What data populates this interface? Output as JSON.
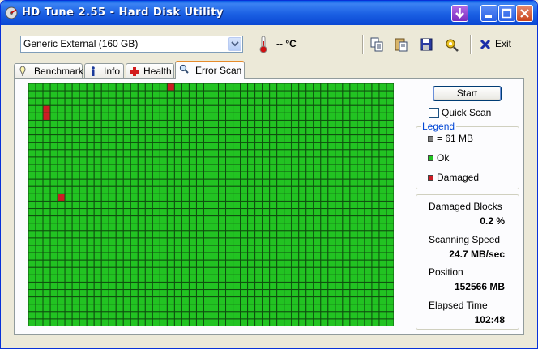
{
  "window": {
    "title": "HD Tune 2.55 - Hard Disk Utility"
  },
  "toolbar": {
    "drive": "Generic External (160 GB)",
    "temperature": "-- °C",
    "exit_label": "Exit"
  },
  "tabs": [
    {
      "label": "Benchmark",
      "icon": "benchmark-icon",
      "active": false
    },
    {
      "label": "Info",
      "icon": "info-icon",
      "active": false
    },
    {
      "label": "Health",
      "icon": "health-icon",
      "active": false
    },
    {
      "label": "Error Scan",
      "icon": "error-scan-icon",
      "active": true
    }
  ],
  "scan": {
    "start_label": "Start",
    "quick_scan_label": "Quick Scan",
    "quick_scan_checked": false,
    "grid_cols": 50,
    "grid_rows": 33,
    "damaged_blocks": [
      [
        19,
        0
      ],
      [
        2,
        3
      ],
      [
        2,
        4
      ],
      [
        4,
        15
      ]
    ]
  },
  "legend": {
    "title": "Legend",
    "items": [
      {
        "label": "= 61 MB",
        "color": "#808080"
      },
      {
        "label": "Ok",
        "color": "#22c322"
      },
      {
        "label": "Damaged",
        "color": "#cc1c24"
      }
    ]
  },
  "stats": [
    {
      "label": "Damaged Blocks",
      "value": "0.2 %"
    },
    {
      "label": "Scanning Speed",
      "value": "24.7 MB/sec"
    },
    {
      "label": "Position",
      "value": "152566 MB"
    },
    {
      "label": "Elapsed Time",
      "value": "102:48"
    }
  ],
  "colors": {
    "ok": "#22c322",
    "damaged": "#cc1c24",
    "grid_line": "#0f4d0f"
  }
}
